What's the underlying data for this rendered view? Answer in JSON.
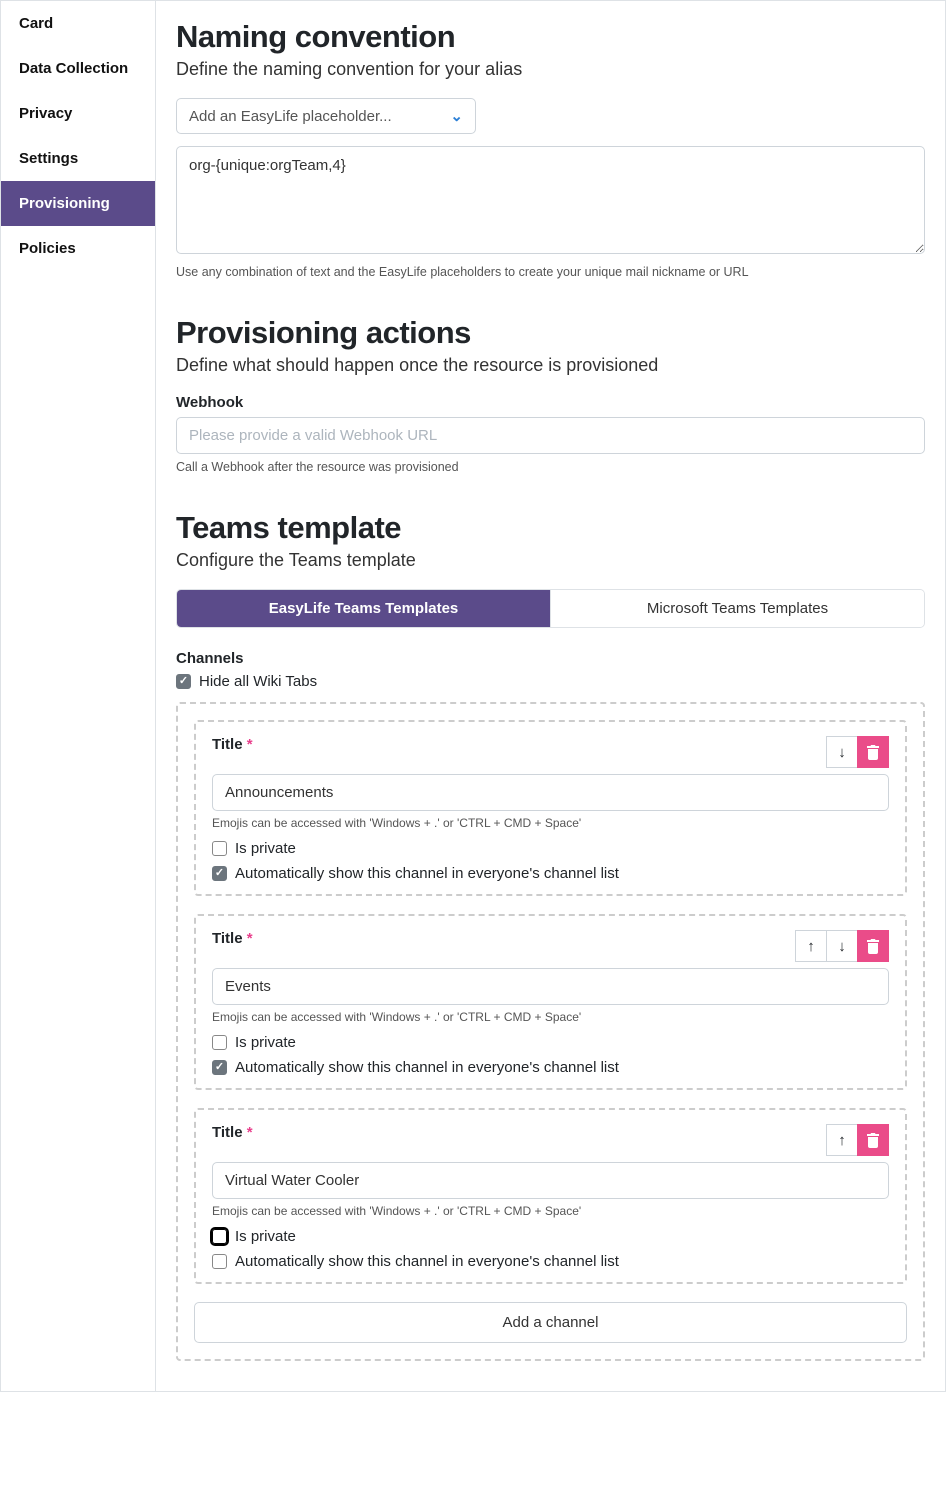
{
  "sidebar": {
    "items": [
      {
        "label": "Card",
        "active": false
      },
      {
        "label": "Data Collection",
        "active": false
      },
      {
        "label": "Privacy",
        "active": false
      },
      {
        "label": "Settings",
        "active": false
      },
      {
        "label": "Provisioning",
        "active": true
      },
      {
        "label": "Policies",
        "active": false
      }
    ]
  },
  "naming": {
    "heading": "Naming convention",
    "subtitle": "Define the naming convention for your alias",
    "placeholder_select": "Add an EasyLife placeholder...",
    "value": "org-{unique:orgTeam,4}",
    "hint": "Use any combination of text and the EasyLife placeholders to create your unique mail nickname or URL"
  },
  "actions": {
    "heading": "Provisioning actions",
    "subtitle": "Define what should happen once the resource is provisioned",
    "webhook_label": "Webhook",
    "webhook_placeholder": "Please provide a valid Webhook URL",
    "webhook_value": "",
    "webhook_hint": "Call a Webhook after the resource was provisioned"
  },
  "template": {
    "heading": "Teams template",
    "subtitle": "Configure the Teams template",
    "tabs": [
      {
        "label": "EasyLife Teams Templates",
        "active": true
      },
      {
        "label": "Microsoft Teams Templates",
        "active": false
      }
    ],
    "channels_label": "Channels",
    "hide_wiki_label": "Hide all Wiki Tabs",
    "hide_wiki_checked": true,
    "title_label": "Title",
    "required_mark": "*",
    "emoji_hint": "Emojis can be accessed with 'Windows + .' or 'CTRL + CMD + Space'",
    "is_private_label": "Is private",
    "auto_show_label": "Automatically show this channel in everyone's channel list",
    "add_channel_label": "Add a channel",
    "channels": [
      {
        "title": "Announcements",
        "is_private": false,
        "auto_show": true,
        "can_up": false,
        "can_down": true,
        "focus_private": false
      },
      {
        "title": "Events",
        "is_private": false,
        "auto_show": true,
        "can_up": true,
        "can_down": true,
        "focus_private": false
      },
      {
        "title": "Virtual Water Cooler",
        "is_private": false,
        "auto_show": false,
        "can_up": true,
        "can_down": false,
        "focus_private": true
      }
    ]
  }
}
